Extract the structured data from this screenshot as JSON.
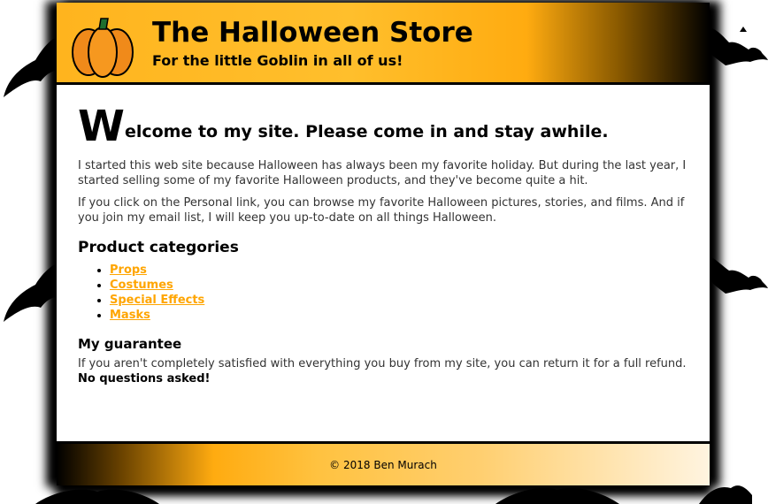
{
  "header": {
    "title": "The Halloween Store",
    "tagline": "For the little Goblin in all of us!"
  },
  "main": {
    "welcome_initial": "W",
    "welcome_rest": "elcome to my site. Please come in and stay awhile.",
    "intro_1": "I started this web site because Halloween has always been my favorite holiday. But during the last year, I started selling some of my favorite Halloween products, and they've become quite a hit.",
    "intro_2": "If you click on the Personal link, you can browse my favorite Halloween pictures, stories, and films. And if you join my email list, I will keep you up-to-date on all things Halloween.",
    "categories_heading": "Product categories",
    "categories": [
      "Props",
      "Costumes",
      "Special Effects",
      "Masks"
    ],
    "guarantee_heading": "My guarantee",
    "guarantee_text": "If you aren't completely satisfied with everything you buy from my site, you can return it for a full refund.",
    "guarantee_bold": "No questions asked!"
  },
  "footer": {
    "copyright": "© 2018 Ben Murach"
  },
  "icons": {
    "logo": "pumpkin-icon",
    "background": "bat-icon"
  },
  "colors": {
    "accent": "#ffa500",
    "header_orange": "#ffb41e",
    "text": "#333333"
  }
}
